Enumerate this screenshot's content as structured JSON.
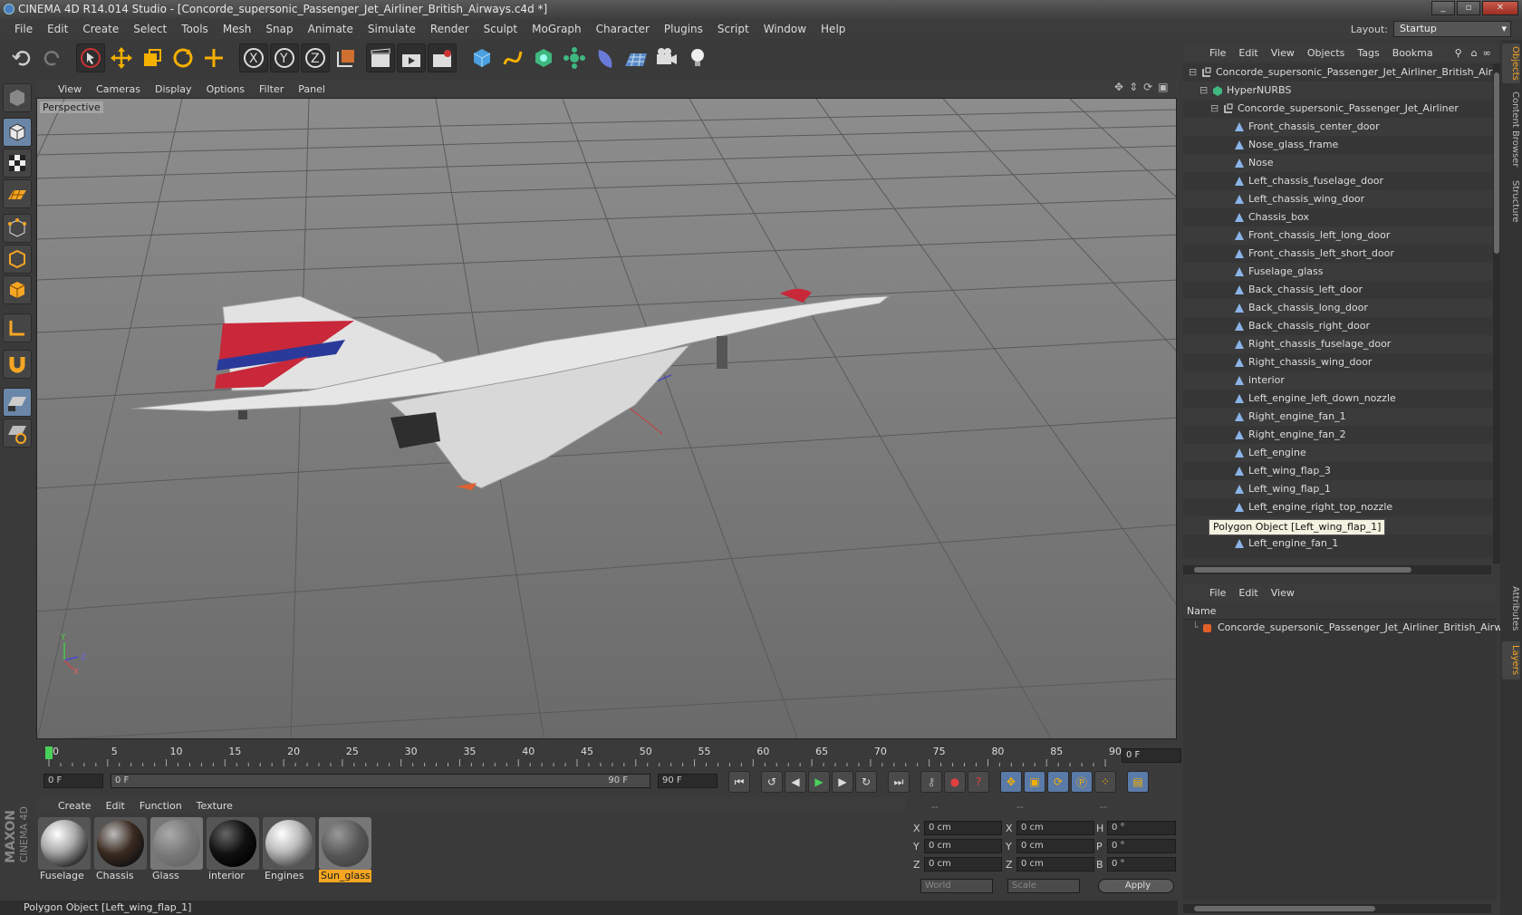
{
  "window": {
    "title": "CINEMA 4D R14.014 Studio - [Concorde_supersonic_Passenger_Jet_Airliner_British_Airways.c4d *]",
    "controls": [
      "_",
      "▫",
      "✕"
    ]
  },
  "menubar": [
    "File",
    "Edit",
    "Create",
    "Select",
    "Tools",
    "Mesh",
    "Snap",
    "Animate",
    "Simulate",
    "Render",
    "Sculpt",
    "MoGraph",
    "Character",
    "Plugins",
    "Script",
    "Window",
    "Help"
  ],
  "layout": {
    "label": "Layout:",
    "value": "Startup"
  },
  "viewport": {
    "menu": [
      "View",
      "Cameras",
      "Display",
      "Options",
      "Filter",
      "Panel"
    ],
    "label": "Perspective",
    "axes": {
      "y": "Y",
      "z": "Z",
      "x": "X"
    }
  },
  "timeline": {
    "ticks": [
      "0",
      "5",
      "10",
      "15",
      "20",
      "25",
      "30",
      "35",
      "40",
      "45",
      "50",
      "55",
      "60",
      "65",
      "70",
      "75",
      "80",
      "85",
      "90"
    ],
    "current_frame": "0 F"
  },
  "playback": {
    "start": "0 F",
    "range_start": "0 F",
    "range_end": "90 F",
    "end": "90 F"
  },
  "materials": {
    "menu": [
      "Create",
      "Edit",
      "Function",
      "Texture"
    ],
    "items": [
      {
        "name": "Fuselage",
        "selected": false
      },
      {
        "name": "Chassis",
        "selected": false
      },
      {
        "name": "Glass",
        "selected": false
      },
      {
        "name": "interior",
        "selected": false
      },
      {
        "name": "Engines",
        "selected": false
      },
      {
        "name": "Sun_glass",
        "selected": true
      }
    ]
  },
  "coords": {
    "headers": [
      "--",
      "--",
      "--"
    ],
    "rows": [
      {
        "a": "X",
        "av": "0 cm",
        "b": "X",
        "bv": "0 cm",
        "c": "H",
        "cv": "0 °"
      },
      {
        "a": "Y",
        "av": "0 cm",
        "b": "Y",
        "bv": "0 cm",
        "c": "P",
        "cv": "0 °"
      },
      {
        "a": "Z",
        "av": "0 cm",
        "b": "Z",
        "bv": "0 cm",
        "c": "B",
        "cv": "0 °"
      }
    ],
    "mode1": "World",
    "mode2": "Scale",
    "apply": "Apply"
  },
  "status": "Polygon Object [Left_wing_flap_1]",
  "brand": {
    "line1": "MAXON",
    "line2": "CINEMA 4D"
  },
  "objects": {
    "menu": [
      "File",
      "Edit",
      "View",
      "Objects",
      "Tags",
      "Bookma"
    ],
    "tree": [
      {
        "name": "Concorde_supersonic_Passenger_Jet_Airliner_British_Airways",
        "level": 0,
        "kind": "null"
      },
      {
        "name": "HyperNURBS",
        "level": 1,
        "kind": "nurbs"
      },
      {
        "name": "Concorde_supersonic_Passenger_Jet_Airliner",
        "level": 2,
        "kind": "null"
      },
      {
        "name": "Front_chassis_center_door",
        "level": 3,
        "kind": "poly"
      },
      {
        "name": "Nose_glass_frame",
        "level": 3,
        "kind": "poly"
      },
      {
        "name": "Nose",
        "level": 3,
        "kind": "poly"
      },
      {
        "name": "Left_chassis_fuselage_door",
        "level": 3,
        "kind": "poly"
      },
      {
        "name": "Left_chassis_wing_door",
        "level": 3,
        "kind": "poly"
      },
      {
        "name": "Chassis_box",
        "level": 3,
        "kind": "poly"
      },
      {
        "name": "Front_chassis_left_long_door",
        "level": 3,
        "kind": "poly"
      },
      {
        "name": "Front_chassis_left_short_door",
        "level": 3,
        "kind": "poly"
      },
      {
        "name": "Fuselage_glass",
        "level": 3,
        "kind": "poly"
      },
      {
        "name": "Back_chassis_left_door",
        "level": 3,
        "kind": "poly"
      },
      {
        "name": "Back_chassis_long_door",
        "level": 3,
        "kind": "poly"
      },
      {
        "name": "Back_chassis_right_door",
        "level": 3,
        "kind": "poly"
      },
      {
        "name": "Right_chassis_fuselage_door",
        "level": 3,
        "kind": "poly"
      },
      {
        "name": "Right_chassis_wing_door",
        "level": 3,
        "kind": "poly"
      },
      {
        "name": "interior",
        "level": 3,
        "kind": "poly"
      },
      {
        "name": "Left_engine_left_down_nozzle",
        "level": 3,
        "kind": "poly"
      },
      {
        "name": "Right_engine_fan_1",
        "level": 3,
        "kind": "poly"
      },
      {
        "name": "Right_engine_fan_2",
        "level": 3,
        "kind": "poly"
      },
      {
        "name": "Left_engine",
        "level": 3,
        "kind": "poly"
      },
      {
        "name": "Left_wing_flap_3",
        "level": 3,
        "kind": "poly"
      },
      {
        "name": "Left_wing_flap_1",
        "level": 3,
        "kind": "poly"
      },
      {
        "name": "Left_engine_right_top_nozzle",
        "level": 3,
        "kind": "poly"
      },
      {
        "name": "zzle",
        "level": 3,
        "kind": "poly"
      },
      {
        "name": "Left_engine_fan_1",
        "level": 3,
        "kind": "poly"
      }
    ],
    "tooltip": "Polygon Object [Left_wing_flap_1]"
  },
  "layers": {
    "menu": [
      "File",
      "Edit",
      "View"
    ],
    "header": "Name",
    "row": "Concorde_supersonic_Passenger_Jet_Airliner_British_Airways",
    "row_color": "#e0602a"
  },
  "sidetabs": {
    "objects": "Objects",
    "content": "Content Browser",
    "structure": "Structure",
    "attributes": "Attributes",
    "layers": "Layers"
  },
  "colors": {
    "accent": "#f5a623",
    "selection": "#6a86a8",
    "livery_red": "#c8283a",
    "livery_blue": "#2a3a9a"
  }
}
